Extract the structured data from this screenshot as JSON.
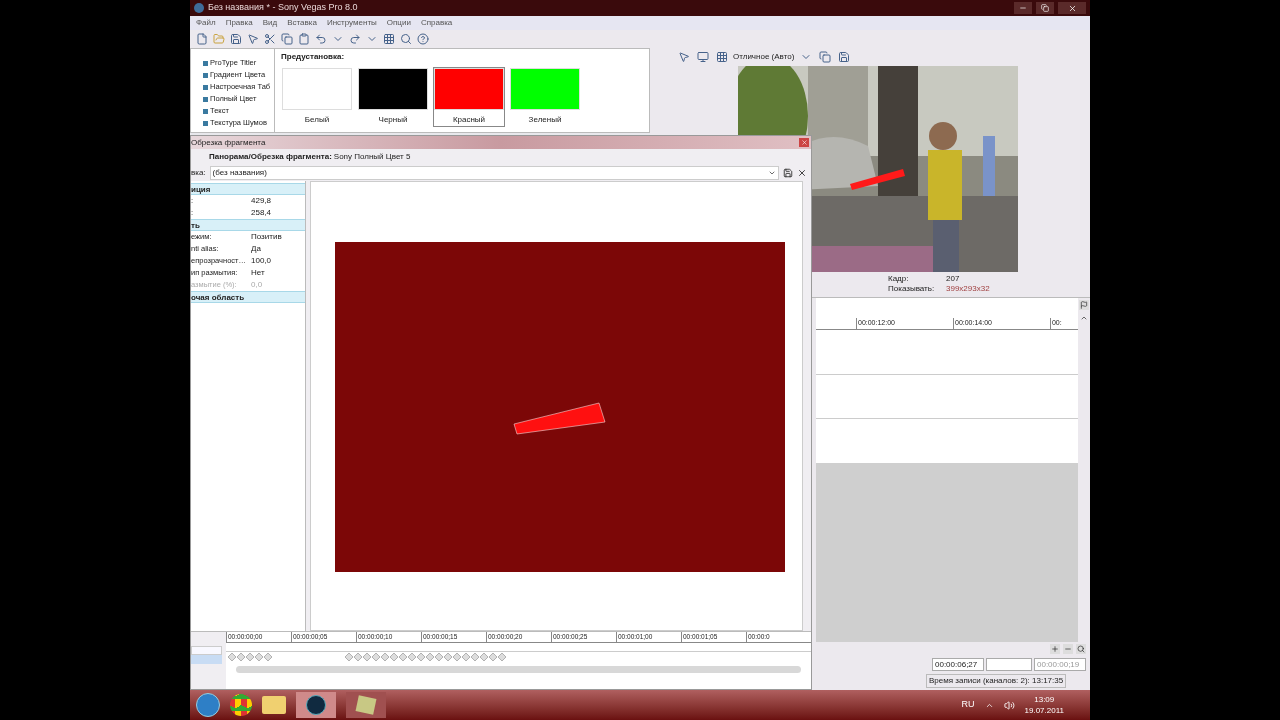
{
  "window": {
    "title": "Без названия * - Sony Vegas Pro 8.0"
  },
  "menu": [
    "Файл",
    "Правка",
    "Вид",
    "Вставка",
    "Инструменты",
    "Опции",
    "Справка"
  ],
  "effects_list": [
    "ProType Titler",
    "Градиент Цвета",
    "Настроечная Таб",
    "Полный Цвет",
    "Текст",
    "Текстура Шумов"
  ],
  "presets": {
    "title": "Предустановка:",
    "items": [
      {
        "label": "Белый",
        "color": "#ffffff",
        "selected": false
      },
      {
        "label": "Черный",
        "color": "#000000",
        "selected": false
      },
      {
        "label": "Красный",
        "color": "#ff0000",
        "selected": true
      },
      {
        "label": "Зеленый",
        "color": "#00ff00",
        "selected": false
      }
    ]
  },
  "preview": {
    "quality": "Отличное (Авто)",
    "frame_label": "Кадр:",
    "frame": "207",
    "display_label": "Показывать:",
    "display": "399x293x32"
  },
  "timeline": {
    "ticks": [
      "00:00:12:00",
      "00:00:14:00",
      "00:"
    ],
    "cursor_time": "00:00:06;27",
    "length_time": "00:00:00;19",
    "record_time": "Время записи (каналов: 2): 13:17:35"
  },
  "dialog": {
    "title": "Обрезка фрагмента",
    "heading_label": "Панорама/Обрезка фрагмента:",
    "heading_value": "Sony Полный Цвет 5",
    "preset_label": "вка:",
    "preset_value": "(без названия)",
    "properties": [
      {
        "kind": "section",
        "label": "иция"
      },
      {
        "kind": "row",
        "label": ":",
        "value": "429,8",
        "disabled": false
      },
      {
        "kind": "row",
        "label": ":",
        "value": "258,4",
        "disabled": false
      },
      {
        "kind": "section",
        "label": "ть"
      },
      {
        "kind": "row",
        "label": "ежим:",
        "value": "Позитив",
        "disabled": false
      },
      {
        "kind": "row",
        "label": "nti alias:",
        "value": "Да",
        "disabled": false
      },
      {
        "kind": "row",
        "label": "епрозрачност…",
        "value": "100,0",
        "disabled": false
      },
      {
        "kind": "row",
        "label": "ип размытия:",
        "value": "Нет",
        "disabled": false
      },
      {
        "kind": "row",
        "label": "азмытие (%):",
        "value": "0,0",
        "disabled": true
      },
      {
        "kind": "section",
        "label": "очая область"
      }
    ],
    "ticks": [
      "00:00:00;00",
      "00:00:00;05",
      "00:00:00;10",
      "00:00:00;15",
      "00:00:00;20",
      "00:00:00;25",
      "00:00:01;00",
      "00:00:01;05",
      "00:00:0"
    ]
  },
  "taskbar": {
    "language": "RU",
    "time": "13:09",
    "date": "19.07.2011"
  }
}
